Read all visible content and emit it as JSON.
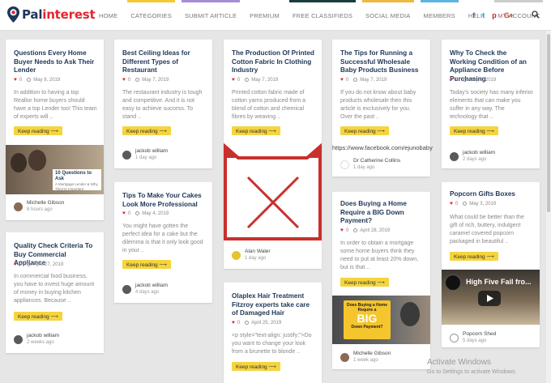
{
  "brand": {
    "name_a": "Pal",
    "name_b": "interest"
  },
  "nav": [
    {
      "label": "HOME",
      "color": ""
    },
    {
      "label": "CATEGORIES",
      "color": "#f5c832"
    },
    {
      "label": "SUBMIT ARTICLE",
      "color": "#a58bd8"
    },
    {
      "label": "PREMIUM",
      "color": ""
    },
    {
      "label": "FREE CLASSIFIEDS",
      "color": "#1a3d3d"
    },
    {
      "label": "SOCIAL MEDIA",
      "color": "#f0b840"
    },
    {
      "label": "MEMBERS",
      "color": "#5ab4e6"
    },
    {
      "label": "HELP",
      "color": ""
    },
    {
      "label": "MY ACCOUNT",
      "color": "#ccc"
    }
  ],
  "social": {
    "facebook": "f",
    "twitter": "t",
    "pinterest": "p",
    "google": "G+"
  },
  "keep_reading": "Keep reading ⟶",
  "cards": [
    {
      "title": "Questions Every Home Buyer Needs to Ask Their Lender",
      "likes": "0",
      "date": "May 8, 2019",
      "excerpt": "In addition to having a top Realtor home buyers should have a top Lender too! This team of experts will ..",
      "thumb_text_a": "10 Questions to Ask",
      "thumb_text_b": "A Mortgage Lender & Why They're Important",
      "author": "Michelle Gibson",
      "ago": "8 hours ago"
    },
    {
      "title": "Quality Check Criteria To Buy Commercial Appliance",
      "likes": "0",
      "date": "April 27, 2019",
      "excerpt": "In commercial food business, you have to invest huge amount of money in buying kitchen appliances. Because ..",
      "author": "jackob william",
      "ago": "2 weeks ago"
    },
    {
      "title": "Best Ceiling Ideas for Different Types of Restaurant",
      "likes": "0",
      "date": "May 7, 2019",
      "excerpt": "The restaurant industry is tough and competitive. And it is not easy to achieve success. To stand ..",
      "author": "jackob william",
      "ago": "1 day ago"
    },
    {
      "title": "Tips To Make Your Cakes Look More Professional",
      "likes": "0",
      "date": "May 4, 2019",
      "excerpt": "You might have gotten the perfect idea for a cake but the dilemma is that it only look good in your ..",
      "author": "jackob william",
      "ago": "4 days ago"
    },
    {
      "title": "The Production Of Printed Cotton Fabric In Clothing Industry",
      "likes": "0",
      "date": "May 7, 2019",
      "excerpt": "Printed cotton fabric made of cotton yarns produced from a blend of cotton and chemical fibres by weaving ..",
      "author": "Alan Waler",
      "ago": "1 day ago"
    },
    {
      "title": "Olaplex Hair Treatment Fitzroy experts take care of Damaged Hair",
      "likes": "0",
      "date": "April 25, 2019",
      "excerpt": "<p style=\"text-align: justify;\">Do you want to change your look from a brunette to blonde ..",
      "author": "",
      "ago": ""
    },
    {
      "title": "The Tips for Running a Successful Wholesale Baby Products Business",
      "likes": "0",
      "date": "May 7, 2019",
      "excerpt": "If you do not know about baby products wholesale then this article is exclusively for you. Over the past ..",
      "url": "https://www.facebook.com/ejunobaby",
      "author": "Dr Catherine Collins",
      "ago": "1 day ago"
    },
    {
      "title": "Does Buying a Home Require a BIG Down Payment?",
      "likes": "0",
      "date": "April 28, 2019",
      "excerpt": "In order to obtain a mortgage some home buyers think they need to put at least 20% down, but is that ..",
      "thumb_text_a": "Does Buying a Home Require a",
      "thumb_text_b": "BIG",
      "thumb_text_c": "Down Payment?",
      "author": "Michelle Gibson",
      "ago": "1 week ago"
    },
    {
      "title": "Why To Check the Working Condition of an Appliance Before Purchasing",
      "likes": "0",
      "date": "May 6, 2019",
      "excerpt": "Today's society has many inferior elements that can make you suffer in any way. The technology that ..",
      "author": "jackob william",
      "ago": "2 days ago"
    },
    {
      "title": "Popcorn Gifts Boxes",
      "likes": "0",
      "date": "May 3, 2019",
      "excerpt": "What could be better than the gift of rich, buttery, indulgent caramel covered popcorn packaged in beautiful ..",
      "video_title": "High Five Fail fro...",
      "author": "Popcorn Shed",
      "ago": "5 days ago"
    }
  ],
  "watermark": {
    "line1": "Activate Windows",
    "line2": "Go to Settings to activate Windows."
  }
}
